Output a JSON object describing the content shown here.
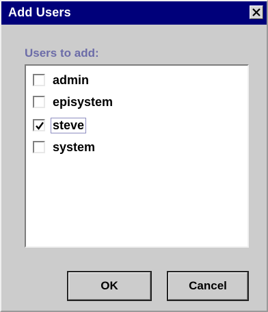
{
  "dialog": {
    "title": "Add Users",
    "close_icon": "close-icon"
  },
  "users_panel": {
    "label": "Users to add:",
    "items": [
      {
        "label": "admin",
        "checked": false
      },
      {
        "label": "episystem",
        "checked": false
      },
      {
        "label": "steve",
        "checked": true
      },
      {
        "label": "system",
        "checked": false
      }
    ]
  },
  "buttons": {
    "ok_label": "OK",
    "cancel_label": "Cancel"
  },
  "colors": {
    "title_bar": "#00007a",
    "dialog_bg": "#cccccc",
    "section_label": "#6c6ca8"
  }
}
